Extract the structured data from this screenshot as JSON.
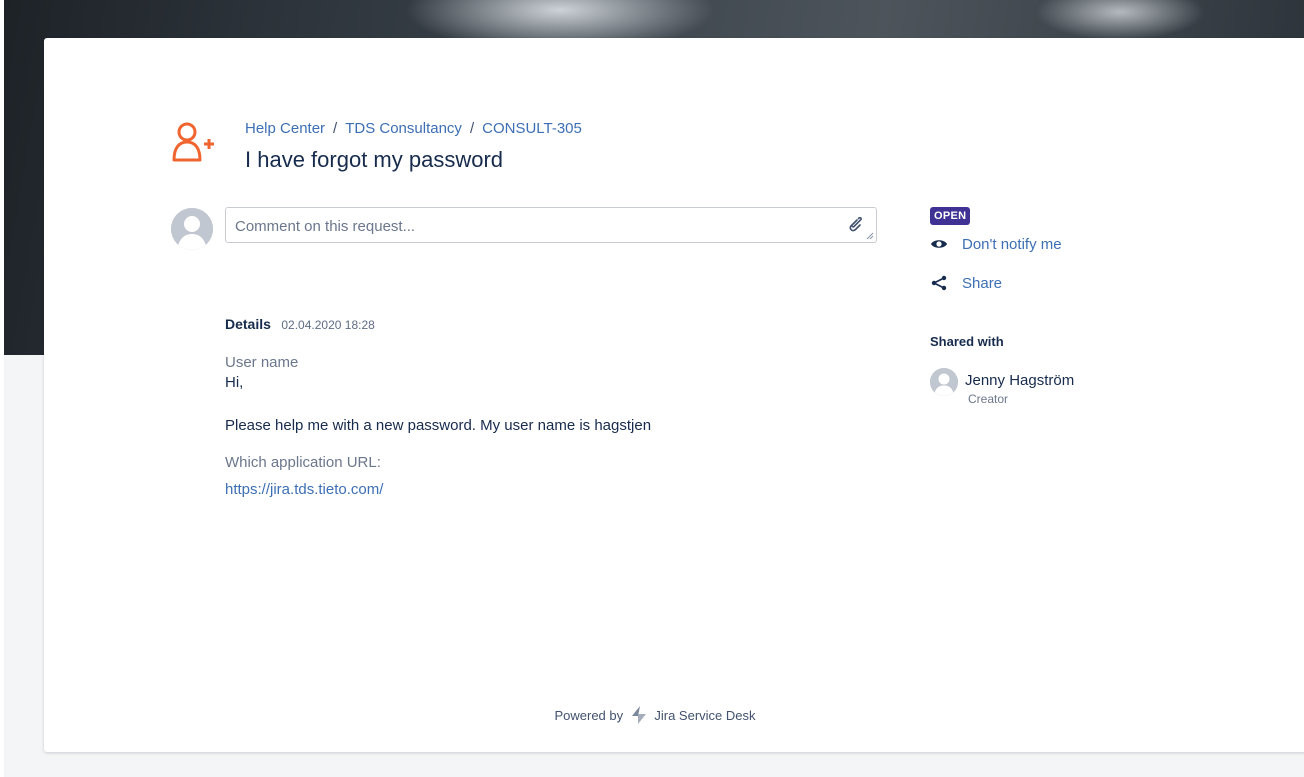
{
  "breadcrumb": {
    "items": [
      "Help Center",
      "TDS Consultancy",
      "CONSULT-305"
    ],
    "separator": "/"
  },
  "request": {
    "title": "I have forgot my password",
    "icon": "add-user-icon",
    "icon_color": "#f0652f"
  },
  "comment": {
    "placeholder": "Comment on this request...",
    "value": ""
  },
  "details": {
    "label": "Details",
    "date": "02.04.2020 18:28",
    "fields": [
      {
        "label": "User name",
        "value": "Hi,"
      },
      {
        "label": "",
        "value": "Please help me with a new password. My user name is hagstjen"
      },
      {
        "label": "Which application URL:",
        "value": "https://jira.tds.tieto.com/"
      }
    ]
  },
  "sidebar": {
    "status": "OPEN",
    "status_color": "#403294",
    "notify_label": "Don't notify me",
    "share_label": "Share",
    "shared_with_title": "Shared with",
    "shared_users": [
      {
        "name": "Jenny Hagström",
        "role": "Creator"
      }
    ]
  },
  "footer": {
    "powered_by": "Powered by",
    "product": "Jira Service Desk"
  },
  "colors": {
    "link": "#3d6fb4",
    "text": "#172b4d",
    "muted": "#6b778c"
  }
}
